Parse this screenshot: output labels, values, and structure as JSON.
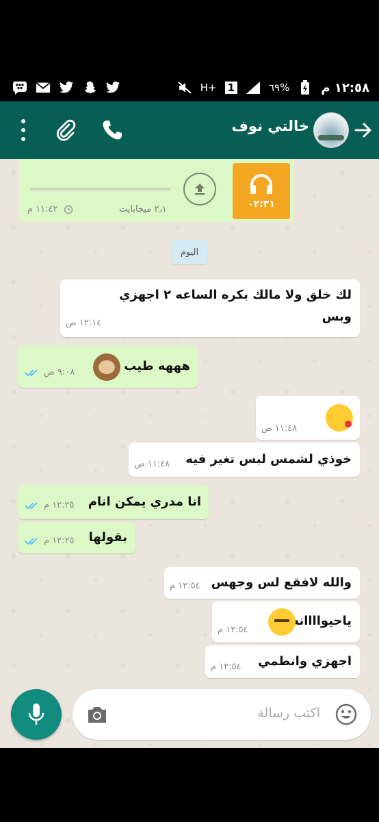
{
  "status_bar": {
    "time": "١٢:٥٨ م",
    "battery": "٦٩%",
    "network": "H+",
    "sim": "1"
  },
  "header": {
    "contact_name": "خالتي نوف"
  },
  "voice_message": {
    "duration": "٠٢:٣١",
    "size": "٢٫١ ميجابايت",
    "time": "١١:٤٢ م"
  },
  "date_chip": "اليوم",
  "messages": [
    {
      "text_line1": "لك خلق ولا مالك بكره الساعه ٢ اجهزي",
      "text_line2": "وبس",
      "time": "١٢:١٤ ص"
    },
    {
      "text": "هههه طيب",
      "time": "٩:٠٨ ص"
    },
    {
      "time": "١١:٤٨ ص"
    },
    {
      "text": "خوذي لشمس لبس تغير فيه",
      "time": "١١:٤٨ ص"
    },
    {
      "text": "انا مدري يمكن انام",
      "time": "١٢:٢٥ م"
    },
    {
      "text": "بقولها",
      "time": "١٢:٢٥ م"
    },
    {
      "text": "والله لافقع لس وجهس",
      "time": "١٢:٥٤ م"
    },
    {
      "text": "ياحيواااانه",
      "time": "١٢:٥٤ م"
    },
    {
      "text": "اجهزي وانطمي",
      "time": "١٢:٥٤ م"
    }
  ],
  "input": {
    "placeholder": "اكتب رسالة"
  },
  "colors": {
    "header": "#075e54",
    "outgoing_bubble": "#dcf8c6",
    "incoming_bubble": "#ffffff",
    "mic_button": "#128c7e",
    "read_ticks": "#4fc3f7",
    "voice_thumb": "#f5a623"
  }
}
